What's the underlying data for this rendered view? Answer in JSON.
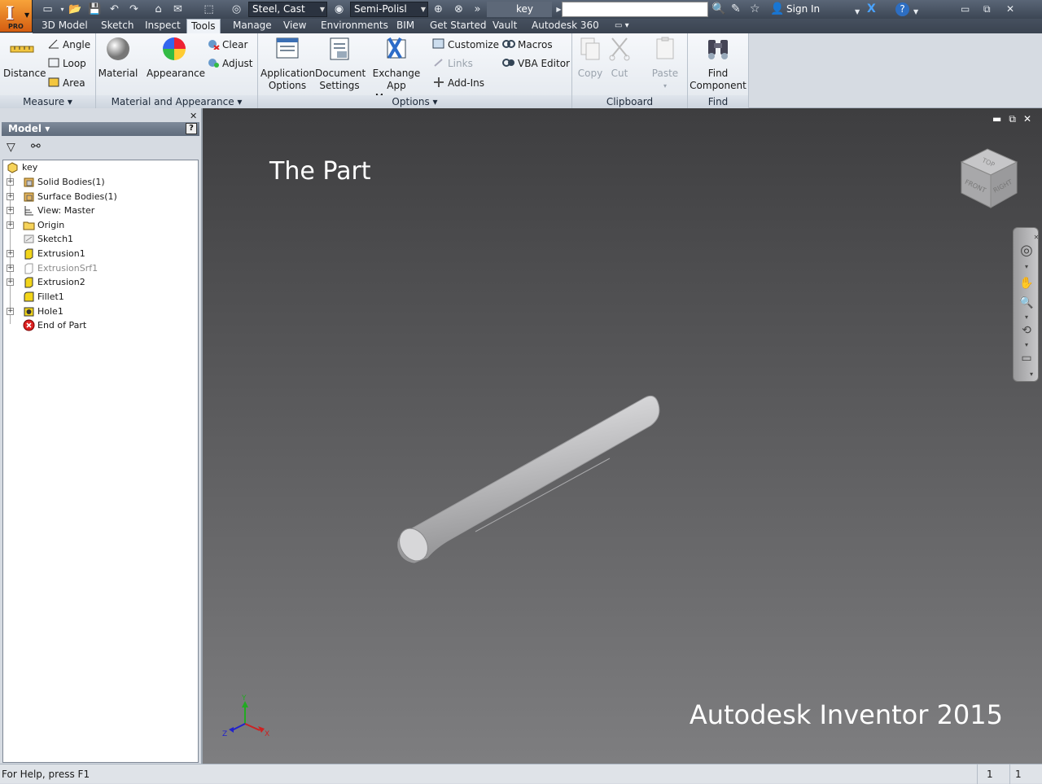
{
  "app": {
    "badge": "PRO",
    "brand": "Autodesk Inventor 2015",
    "overlay_title": "The Part"
  },
  "qat": {
    "material": "Steel, Cast",
    "appearance": "Semi-Polisl",
    "doc_tab": "key",
    "sign_in": "Sign In"
  },
  "tabs": [
    "3D Model",
    "Sketch",
    "Inspect",
    "Tools",
    "Manage",
    "View",
    "Environments",
    "BIM",
    "Get Started",
    "Vault",
    "Autodesk 360"
  ],
  "active_tab": "Tools",
  "ribbon": {
    "measure": {
      "title": "Measure",
      "distance": "Distance",
      "angle": "Angle",
      "loop": "Loop",
      "area": "Area"
    },
    "material_appearance": {
      "title": "Material and Appearance",
      "material": "Material",
      "appearance": "Appearance",
      "clear": "Clear",
      "adjust": "Adjust"
    },
    "options": {
      "title": "Options",
      "app_options_1": "Application",
      "app_options_2": "Options",
      "doc_settings_1": "Document",
      "doc_settings_2": "Settings",
      "exchange_1": "Exchange",
      "exchange_2": "App Manager",
      "customize": "Customize",
      "links": "Links",
      "addins": "Add-Ins",
      "macros": "Macros",
      "vba": "VBA Editor"
    },
    "clipboard": {
      "title": "Clipboard",
      "copy": "Copy",
      "cut": "Cut",
      "paste": "Paste"
    },
    "find": {
      "title": "Find",
      "find_1": "Find",
      "find_2": "Component"
    }
  },
  "browser": {
    "header": "Model",
    "items": [
      {
        "label": "key",
        "icon": "part-icon"
      },
      {
        "label": "Solid Bodies(1)",
        "icon": "solid-bodies-icon"
      },
      {
        "label": "Surface Bodies(1)",
        "icon": "surface-bodies-icon"
      },
      {
        "label": "View: Master",
        "icon": "view-icon"
      },
      {
        "label": "Origin",
        "icon": "folder-icon"
      },
      {
        "label": "Sketch1",
        "icon": "sketch-icon"
      },
      {
        "label": "Extrusion1",
        "icon": "extrusion-icon"
      },
      {
        "label": "ExtrusionSrf1",
        "icon": "extrusion-surface-icon"
      },
      {
        "label": "Extrusion2",
        "icon": "extrusion-icon"
      },
      {
        "label": "Fillet1",
        "icon": "fillet-icon"
      },
      {
        "label": "Hole1",
        "icon": "hole-icon"
      },
      {
        "label": "End of Part",
        "icon": "end-of-part-icon"
      }
    ]
  },
  "viewcube": {
    "top": "TOP",
    "front": "FRONT",
    "right": "RIGHT"
  },
  "triad": {
    "x": "X",
    "y": "Y",
    "z": "Z"
  },
  "status": {
    "message": "For Help, press F1",
    "count1": "1",
    "count2": "1"
  }
}
